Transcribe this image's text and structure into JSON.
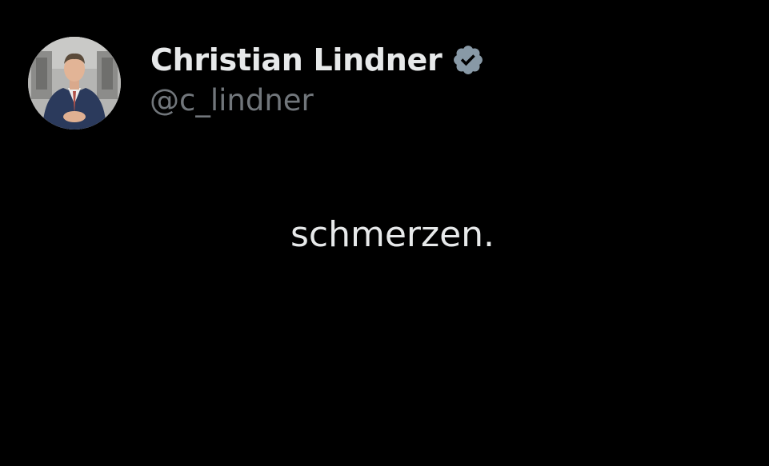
{
  "author": {
    "display_name": "Christian Lindner",
    "handle": "@c_lindner",
    "verified": true,
    "avatar_icon": "profile-photo"
  },
  "tweet": {
    "text": "schmerzen."
  },
  "colors": {
    "background": "#000000",
    "primary_text": "#e7e9ea",
    "secondary_text": "#71767b",
    "verified_badge": "#8899a6"
  }
}
